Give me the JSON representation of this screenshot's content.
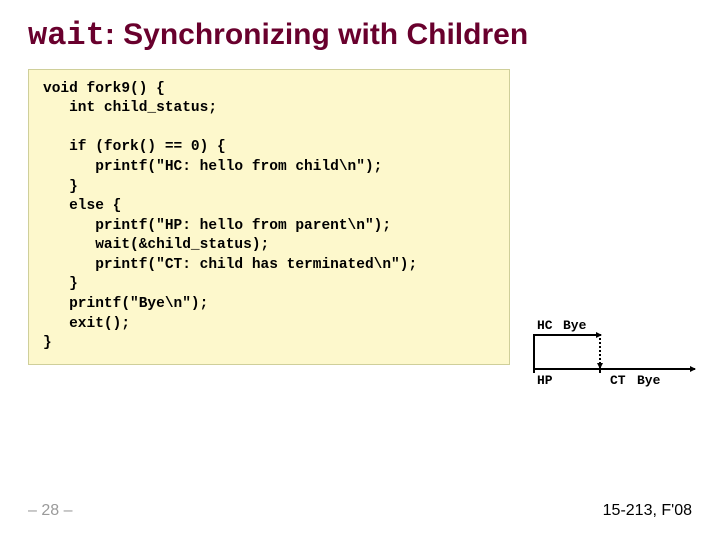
{
  "title": {
    "code_word": "wait",
    "rest": ": Synchronizing with Children"
  },
  "code": "void fork9() {\n   int child_status;\n\n   if (fork() == 0) {\n      printf(\"HC: hello from child\\n\");\n   }\n   else {\n      printf(\"HP: hello from parent\\n\");\n      wait(&child_status);\n      printf(\"CT: child has terminated\\n\");\n   }\n   printf(\"Bye\\n\");\n   exit();\n}",
  "diagram": {
    "hc": "HC",
    "bye_top": "Bye",
    "hp": "HP",
    "ct": "CT",
    "bye_bot": "Bye"
  },
  "footer": {
    "left": "– 28 –",
    "right": "15-213, F'08"
  }
}
